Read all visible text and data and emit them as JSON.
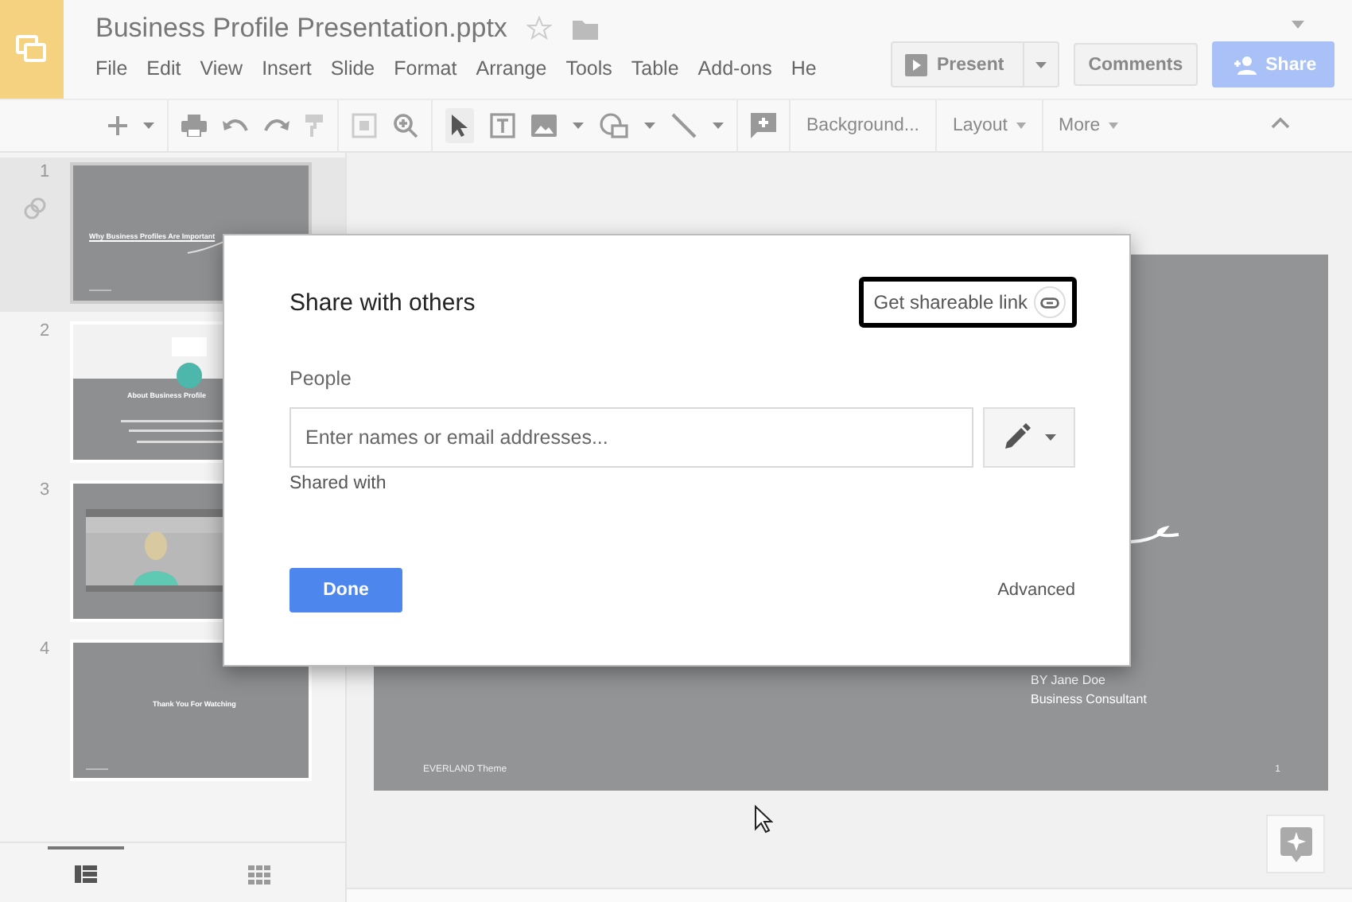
{
  "app": {
    "title": "Business Profile Presentation.pptx",
    "starred": false
  },
  "menu": [
    "File",
    "Edit",
    "View",
    "Insert",
    "Slide",
    "Format",
    "Arrange",
    "Tools",
    "Table",
    "Add-ons",
    "He"
  ],
  "header_buttons": {
    "present": "Present",
    "comments": "Comments",
    "share": "Share"
  },
  "toolbar": {
    "background": "Background...",
    "layout": "Layout",
    "more": "More"
  },
  "slides": [
    {
      "number": "1",
      "selected": true,
      "kind": "title",
      "title": "Why Business Profiles Are Important"
    },
    {
      "number": "2",
      "selected": false,
      "kind": "section",
      "title": "About Business Profile"
    },
    {
      "number": "3",
      "selected": false,
      "kind": "video"
    },
    {
      "number": "4",
      "selected": false,
      "kind": "closing",
      "title": "Thank You For Watching"
    }
  ],
  "filmstrip_views": [
    {
      "kind": "list",
      "selected": true
    },
    {
      "kind": "grid",
      "selected": false
    }
  ],
  "slide": {
    "byline": "BY Jane Doe",
    "role": "Business Consultant",
    "footer": "EVERLAND Theme",
    "page": "1"
  },
  "dialog": {
    "title": "Share with others",
    "link": {
      "label": "Get shareable link",
      "highlighted": true
    },
    "section": "People",
    "placeholder": "Enter names or email addresses...",
    "shared_with": "Shared with",
    "done": "Done",
    "advanced": "Advanced"
  }
}
